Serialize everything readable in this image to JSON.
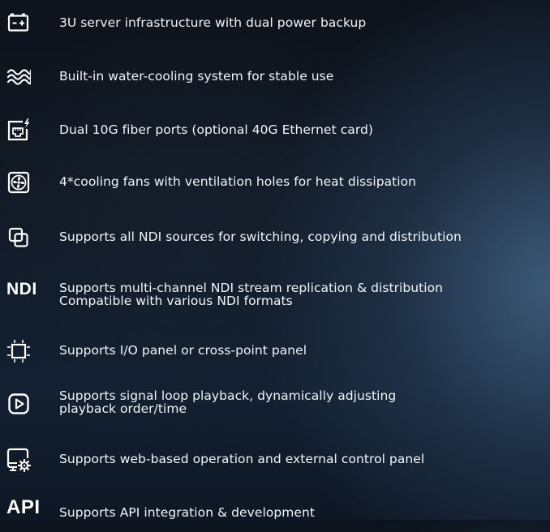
{
  "features": [
    {
      "icon": "battery-icon",
      "text": "3U server infrastructure with dual power backup"
    },
    {
      "icon": "water-wave-icon",
      "text": "Built-in water-cooling system for stable use"
    },
    {
      "icon": "ethernet-port-icon",
      "text": "Dual 10G fiber ports (optional 40G Ethernet card)"
    },
    {
      "icon": "cooling-fan-icon",
      "text": "4*cooling fans with ventilation holes for heat dissipation"
    },
    {
      "icon": "copy-layers-icon",
      "text": "Supports all NDI sources for switching, copying and distribution"
    },
    {
      "icon_text": "NDI",
      "text_lines": [
        "Supports multi-channel NDI stream replication & distribution",
        "Compatible with various NDI formats"
      ]
    },
    {
      "icon": "panel-frame-icon",
      "text": "Supports I/O panel or cross-point panel"
    },
    {
      "icon": "play-button-icon",
      "text_lines": [
        "Supports signal loop playback, dynamically adjusting",
        "playback order/time"
      ]
    },
    {
      "icon": "screen-gear-icon",
      "text": "Supports web-based operation and external control panel"
    },
    {
      "icon_text": "API",
      "text": "Supports API integration & development"
    }
  ],
  "colors": {
    "text": "#f2f5f9",
    "icon": "#ffffff",
    "background_dark": "#0d131c",
    "background_highlight": "#3e5c7c"
  }
}
